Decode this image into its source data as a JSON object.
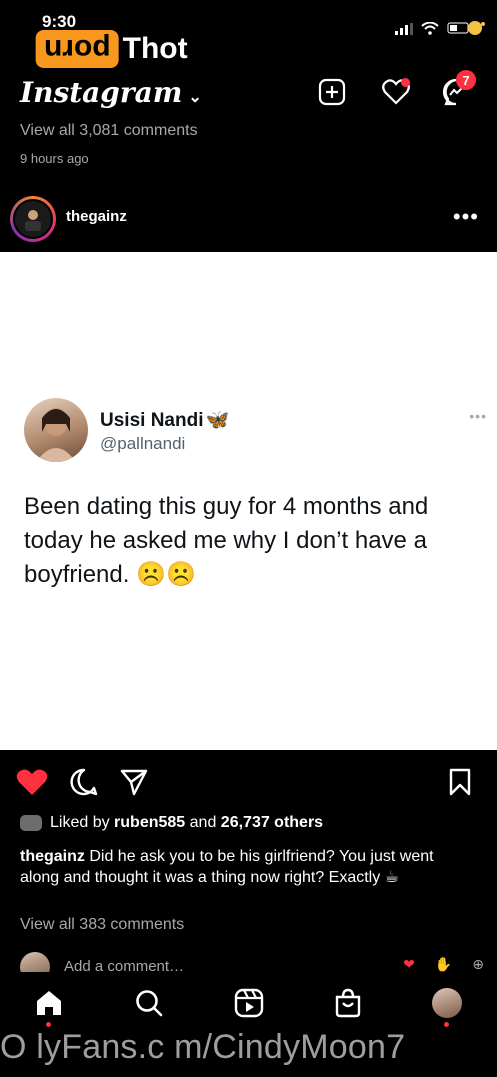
{
  "status_bar": {
    "time": "9:30"
  },
  "watermark": {
    "box_text": "porn",
    "text": "Thot",
    "bottom_text": "O lyFans.c m/CindyMoon7"
  },
  "header": {
    "app_name": "Instagram",
    "notifications_count": "7"
  },
  "previous_post": {
    "comments_link": "View all 3,081 comments",
    "timestamp": "9 hours ago"
  },
  "post": {
    "username": "thegainz",
    "more_label": "•••",
    "tweet": {
      "name": "Usisi Nandi",
      "handle": "@pallnandi",
      "text": "Been dating this guy for 4 months and today he asked me why I don’t have a boyfriend. ☹️☹️"
    },
    "likes": {
      "prefix": "Liked by",
      "user": "ruben585",
      "and": "and",
      "others": "26,737 others"
    },
    "caption": {
      "username": "thegainz",
      "text": "Did he ask you to be his girlfriend? You just went along and thought it was a thing now right? Exactly ☕"
    },
    "comments_link": "View all 383 comments",
    "add_comment_placeholder": "Add a comment…"
  },
  "colors": {
    "accent_red": "#ff3040",
    "tweet_blue": "#1d9bf0",
    "muted_text": "#a8a8a8"
  },
  "icons": [
    "home-icon",
    "search-icon",
    "reels-icon",
    "shop-icon",
    "profile-avatar",
    "heart-icon",
    "comment-icon",
    "share-icon",
    "bookmark-icon",
    "new-post-icon",
    "activity-icon",
    "messenger-icon"
  ]
}
